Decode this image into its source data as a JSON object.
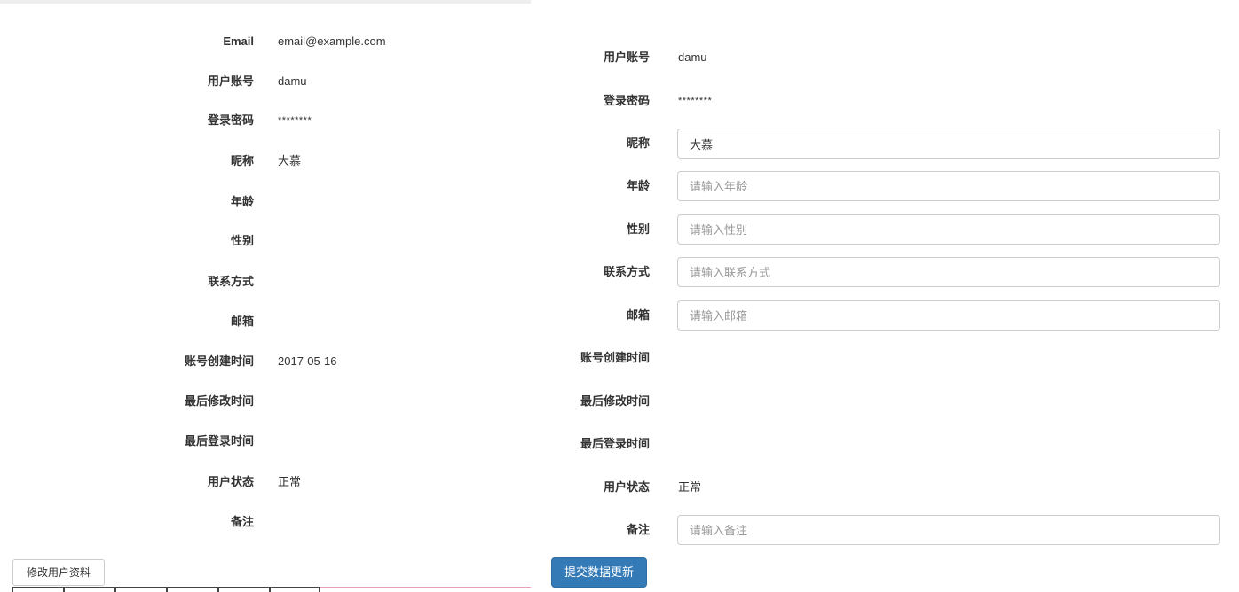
{
  "view_panel": {
    "fields": [
      {
        "label": "Email",
        "value": "email@example.com"
      },
      {
        "label": "用户账号",
        "value": "damu"
      },
      {
        "label": "登录密码",
        "value": "********"
      },
      {
        "label": "昵称",
        "value": "大慕"
      },
      {
        "label": "年龄",
        "value": ""
      },
      {
        "label": "性别",
        "value": ""
      },
      {
        "label": "联系方式",
        "value": ""
      },
      {
        "label": "邮箱",
        "value": ""
      },
      {
        "label": "账号创建时间",
        "value": "2017-05-16"
      },
      {
        "label": "最后修改时间",
        "value": ""
      },
      {
        "label": "最后登录时间",
        "value": ""
      },
      {
        "label": "用户状态",
        "value": "正常"
      },
      {
        "label": "备注",
        "value": ""
      }
    ],
    "edit_button_label": "修改用户资料"
  },
  "edit_panel": {
    "account": {
      "label": "用户账号",
      "value": "damu"
    },
    "password": {
      "label": "登录密码",
      "value": "********"
    },
    "nickname": {
      "label": "昵称",
      "value": "大慕",
      "placeholder": ""
    },
    "age": {
      "label": "年龄",
      "value": "",
      "placeholder": "请输入年龄"
    },
    "gender": {
      "label": "性别",
      "value": "",
      "placeholder": "请输入性别"
    },
    "contact": {
      "label": "联系方式",
      "value": "",
      "placeholder": "请输入联系方式"
    },
    "email": {
      "label": "邮箱",
      "value": "",
      "placeholder": "请输入邮箱"
    },
    "created": {
      "label": "账号创建时间",
      "value": ""
    },
    "modified": {
      "label": "最后修改时间",
      "value": ""
    },
    "last_login": {
      "label": "最后登录时间",
      "value": ""
    },
    "status": {
      "label": "用户状态",
      "value": "正常"
    },
    "remark": {
      "label": "备注",
      "value": "",
      "placeholder": "请输入备注"
    },
    "submit_label": "提交数据更新"
  },
  "colors": {
    "primary": "#337ab7",
    "primary_border": "#2e6da4",
    "input_border": "#cccccc",
    "placeholder": "#999999",
    "text": "#333333"
  }
}
